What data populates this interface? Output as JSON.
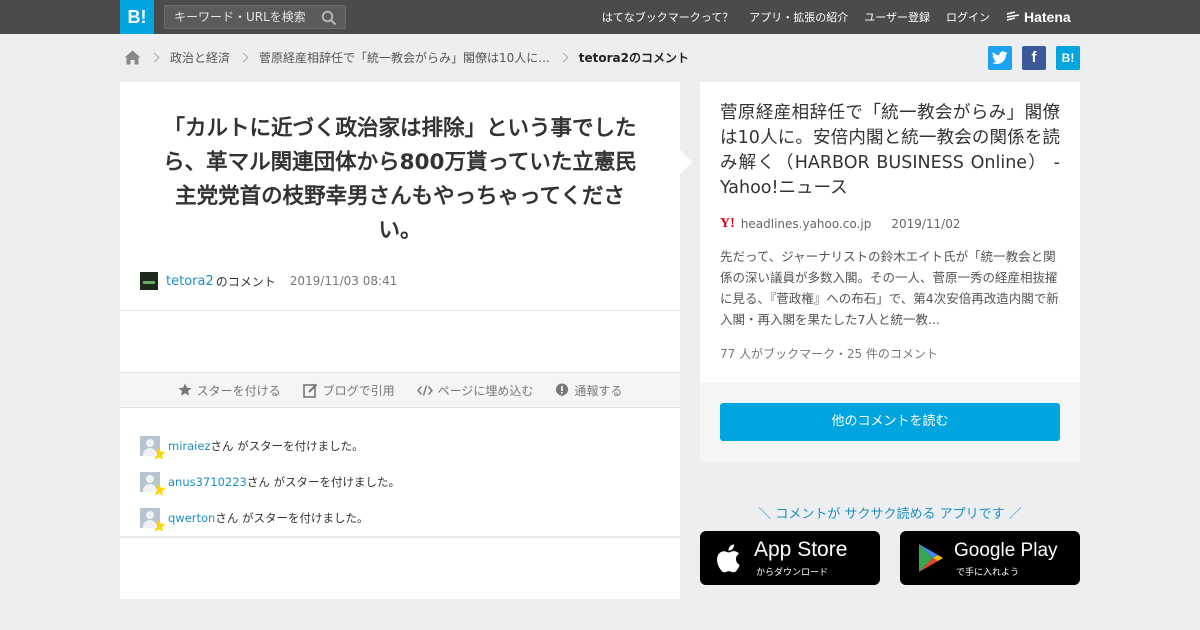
{
  "topbar": {
    "logo": "B!",
    "search_placeholder": "キーワード・URLを検索",
    "nav": [
      "はてなブックマークって？",
      "アプリ・拡張の紹介",
      "ユーザー登録",
      "ログイン"
    ],
    "brand": "Hatena"
  },
  "breadcrumb": {
    "items": [
      "政治と経済",
      "菅原経産相辞任で「統一教会がらみ」閣僚は10人に...",
      "tetora2のコメント"
    ]
  },
  "share": {
    "twitter": "t",
    "facebook": "f",
    "hatena": "B!",
    "colors": {
      "twitter": "#1da1f2",
      "facebook": "#3b5998",
      "hatena": "#00a4de"
    }
  },
  "comment": {
    "text": "「カルトに近づく政治家は排除」という事でしたら、革マル関連団体から800万貰っていた立憲民主党党首の枝野幸男さんもやっちゃってください。",
    "user": "tetora2",
    "user_suffix": "のコメント",
    "date": "2019/11/03 08:41"
  },
  "actions": [
    "スターを付ける",
    "ブログで引用",
    "ページに埋め込む",
    "通報する"
  ],
  "stars": [
    {
      "user": "miraiez",
      "text": "さん がスターを付けました。"
    },
    {
      "user": "anus3710223",
      "text": "さん がスターを付けました。"
    },
    {
      "user": "qwerton",
      "text": "さん がスターを付けました。"
    }
  ],
  "article": {
    "title": "菅原経産相辞任で「統一教会がらみ」閣僚は10人に。安倍内閣と統一教会の関係を読み解く（HARBOR BUSINESS Online） - Yahoo!ニュース",
    "site_icon": "Y!",
    "site": "headlines.yahoo.co.jp",
    "date": "2019/11/02",
    "description": "先だって、ジャーナリストの鈴木エイト氏が「統一教会と関係の深い議員が多数入閣。その一人、菅原一秀の経産相抜擢に見る、『菅政権』への布石」で、第4次安倍再改造内閣で新入閣・再入閣を果たした7人と統一教...",
    "count": "77 人がブックマーク・25 件のコメント"
  },
  "read_button": "他のコメントを読む",
  "promo": {
    "text": "＼ コメントが サクサク読める アプリです ／",
    "appstore_title": "App Store",
    "appstore_sub": "からダウンロード",
    "googleplay_title": "Google Play",
    "googleplay_sub": "で手に入れよう"
  },
  "colors": {
    "accent": "#00a4de",
    "link": "#1d8fc2",
    "topbar": "#4b4b4b",
    "star": "#ffd400"
  }
}
